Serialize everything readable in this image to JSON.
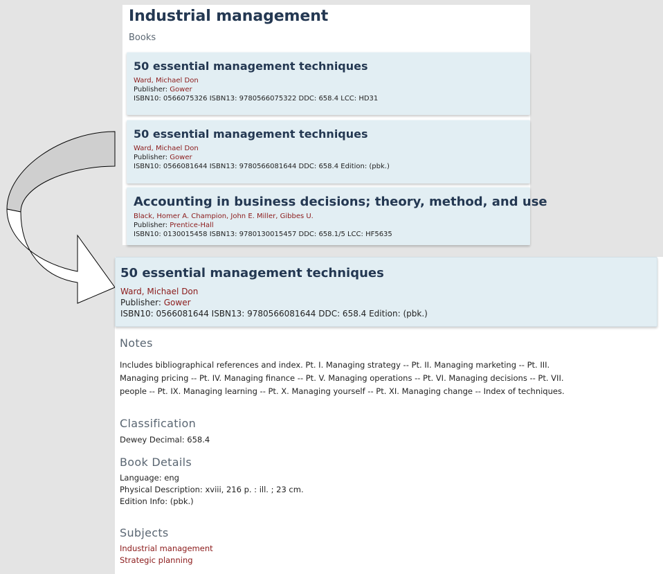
{
  "top": {
    "title": "Industrial management",
    "subtitle": "Books",
    "books": [
      {
        "title": "50 essential management techniques",
        "author": "Ward, Michael Don",
        "publisher_label": "Publisher:",
        "publisher": "Gower",
        "ids": "ISBN10: 0566075326 ISBN13: 9780566075322 DDC: 658.4 LCC: HD31"
      },
      {
        "title": "50 essential management techniques",
        "author": "Ward, Michael Don",
        "publisher_label": "Publisher:",
        "publisher": "Gower",
        "ids": "ISBN10: 0566081644 ISBN13: 9780566081644 DDC: 658.4 Edition: (pbk.)"
      },
      {
        "title": "Accounting in business decisions; theory, method, and use",
        "authors": [
          "Black, Homer A.",
          "Champion, John E.",
          "Miller, Gibbes U."
        ],
        "publisher_label": "Publisher:",
        "publisher": "Prentice-Hall",
        "ids": "ISBN10: 0130015458 ISBN13: 9780130015457 DDC: 658.1/5 LCC: HF5635"
      }
    ]
  },
  "detail": {
    "title": "50 essential management techniques",
    "author": "Ward, Michael Don",
    "publisher_label": "Publisher:",
    "publisher": "Gower",
    "ids": "ISBN10: 0566081644 ISBN13: 9780566081644 DDC: 658.4 Edition: (pbk.)",
    "notes_heading": "Notes",
    "notes_lines": [
      "Includes bibliographical references and index. Pt. I. Managing strategy -- Pt. II. Managing marketing -- Pt. III.",
      "Managing pricing -- Pt. IV. Managing finance -- Pt. V. Managing operations -- Pt. VI. Managing decisions -- Pt. VII.",
      "people -- Pt. IX. Managing learning -- Pt. X. Managing yourself -- Pt. XI. Managing change -- Index of techniques."
    ],
    "classification_heading": "Classification",
    "dewey": "Dewey Decimal: 658.4",
    "details_heading": "Book Details",
    "language": "Language: eng",
    "physical": "Physical Description: xviii, 216 p. : ill. ; 23 cm.",
    "edition": "Edition Info: (pbk.)",
    "subjects_heading": "Subjects",
    "subjects": [
      "Industrial management",
      "Strategic planning"
    ]
  }
}
